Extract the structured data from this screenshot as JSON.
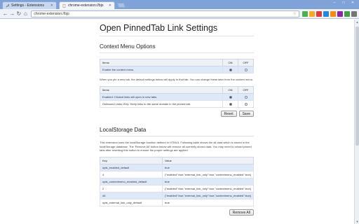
{
  "browser": {
    "tabs": [
      {
        "label": "Settings - Extensions",
        "active": false
      },
      {
        "label": "chrome-extension://bjo",
        "active": true
      }
    ],
    "address": "chrome-extension://bjo",
    "window_controls": [
      "–",
      "□",
      "✕"
    ]
  },
  "page": {
    "title": "Open PinnedTab Link Settings",
    "context_menu": {
      "heading": "Context Menu Options",
      "table": {
        "headers": [
          "Items",
          "ON",
          "OFF"
        ],
        "rows": [
          {
            "label": "Enable the context menu.",
            "on": true
          }
        ]
      },
      "description": "When you pin a new tab, the default settings below will apply to that tab. You can change these later from the context menu.",
      "table2": {
        "headers": [
          "Items",
          "ON",
          "OFF"
        ],
        "rows": [
          {
            "label": "Enabled: Clicked links will open in new tabs.",
            "on": true
          },
          {
            "label": "Outbound Links Only: Keep links to the same domain in the pinned tab.",
            "on": true
          }
        ]
      },
      "reset_label": "Reset",
      "save_label": "Save"
    },
    "local_storage": {
      "heading": "LocalStorage Data",
      "description": "This extension uses the localStorage function defined in HTML5. Following table shows the all data which is stored in the localStorage database. The 'Remove All' button below will remove all currently stored data. You may need to reload pinned tabs after resetting this button to ensure the proper settings are applied.",
      "headers": [
        "Key",
        "Value"
      ],
      "rows": [
        {
          "key": "opts_enabled_default",
          "value": "true"
        },
        {
          "key": "4",
          "value": "{\"enabled\":true,\"external_link_only\":true,\"contextmenu_enabled\":true}"
        },
        {
          "key": "opts_contextmenu_enabled_default",
          "value": "true"
        },
        {
          "key": "2",
          "value": "{\"enabled\":true,\"external_link_only\":true,\"contextmenu_enabled\":true}"
        },
        {
          "key": "46",
          "value": "{\"enabled\":true,\"external_link_only\":true,\"contextmenu_enabled\":true}"
        },
        {
          "key": "opts_external_link_only_default",
          "value": "true"
        }
      ],
      "remove_all_label": "Remove All"
    }
  },
  "colors": {
    "tab_strip": "#7fa3d9",
    "highlight_row": "#dde8f8"
  }
}
